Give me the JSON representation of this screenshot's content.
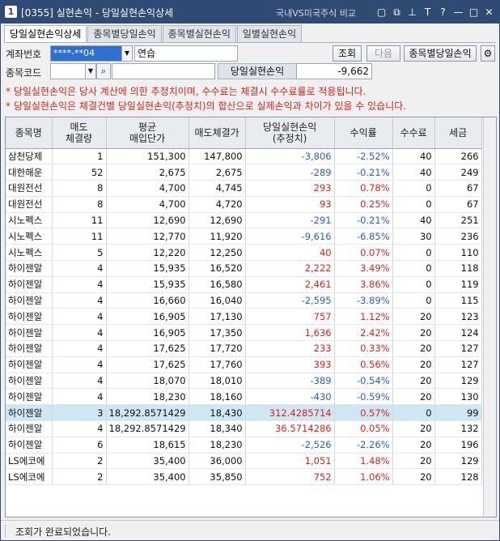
{
  "window": {
    "number": "1",
    "title": "[0355] 실현손익 - 당일실현손익상세",
    "compare_link": "국내VS미국주식 비교",
    "icons": [
      "window-icon",
      "copy-icon",
      "pin-icon",
      "font-size-icon",
      "help-icon",
      "minimize-icon",
      "maximize-icon",
      "close-icon"
    ],
    "icon_glyphs": [
      "▢",
      "⧉",
      "⊥",
      "T",
      "?",
      "—",
      "□",
      "✕"
    ]
  },
  "tabs": [
    {
      "label": "당일실현손익상세",
      "active": true
    },
    {
      "label": "종목별당일손익",
      "active": false
    },
    {
      "label": "종목별실현손익",
      "active": false
    },
    {
      "label": "일별실현손익",
      "active": false
    }
  ],
  "form": {
    "account_label": "계좌번호",
    "account_value": "****-**04",
    "account_name": "연습",
    "stock_code_label": "종목코드",
    "stock_code_value": "",
    "stock_name_value": "",
    "query_button": "조회",
    "next_button": "다음",
    "by_stock_button": "종목별당일손익",
    "pnl_label": "당일실현손익",
    "pnl_value": "-9,662"
  },
  "notices": [
    "* 당일실현손익은 당사 계산에 의한 추정치이며, 수수료는 체결시 수수료률로 적용됩니다.",
    "* 당일실현손익은 체결건별 당일실현손익(추정치)의 합산으로 실제손익과 차이가 있을 수 있습니다."
  ],
  "table": {
    "headers": [
      "종목명",
      "매도\n체결량",
      "평균\n매입단가",
      "매도체결가",
      "당일실현손익\n(추정치)",
      "수익률",
      "수수료",
      "세금"
    ],
    "rows": [
      {
        "name": "삼천당제",
        "qty": "1",
        "avg": "151,300",
        "sell": "147,800",
        "pnl": "-3,806",
        "rate": "-2.52%",
        "fee": "40",
        "tax": "266",
        "sign": "neg"
      },
      {
        "name": "대한해운",
        "qty": "52",
        "avg": "2,675",
        "sell": "2,675",
        "pnl": "-289",
        "rate": "-0.21%",
        "fee": "40",
        "tax": "249",
        "sign": "neg"
      },
      {
        "name": "대원전선",
        "qty": "8",
        "avg": "4,700",
        "sell": "4,745",
        "pnl": "293",
        "rate": "0.78%",
        "fee": "0",
        "tax": "67",
        "sign": "pos"
      },
      {
        "name": "대원전선",
        "qty": "8",
        "avg": "4,700",
        "sell": "4,720",
        "pnl": "93",
        "rate": "0.25%",
        "fee": "0",
        "tax": "67",
        "sign": "pos"
      },
      {
        "name": "시노펙스",
        "qty": "11",
        "avg": "12,690",
        "sell": "12,690",
        "pnl": "-291",
        "rate": "-0.21%",
        "fee": "40",
        "tax": "251",
        "sign": "neg"
      },
      {
        "name": "시노펙스",
        "qty": "11",
        "avg": "12,770",
        "sell": "11,920",
        "pnl": "-9,616",
        "rate": "-6.85%",
        "fee": "30",
        "tax": "236",
        "sign": "neg"
      },
      {
        "name": "시노펙스",
        "qty": "5",
        "avg": "12,220",
        "sell": "12,250",
        "pnl": "40",
        "rate": "0.07%",
        "fee": "0",
        "tax": "110",
        "sign": "pos"
      },
      {
        "name": "하이젠알",
        "qty": "4",
        "avg": "15,935",
        "sell": "16,520",
        "pnl": "2,222",
        "rate": "3.49%",
        "fee": "0",
        "tax": "118",
        "sign": "pos"
      },
      {
        "name": "하이젠알",
        "qty": "4",
        "avg": "15,935",
        "sell": "16,580",
        "pnl": "2,461",
        "rate": "3.86%",
        "fee": "0",
        "tax": "119",
        "sign": "pos"
      },
      {
        "name": "하이젠알",
        "qty": "4",
        "avg": "16,660",
        "sell": "16,040",
        "pnl": "-2,595",
        "rate": "-3.89%",
        "fee": "0",
        "tax": "115",
        "sign": "neg"
      },
      {
        "name": "하이젠알",
        "qty": "4",
        "avg": "16,905",
        "sell": "17,130",
        "pnl": "757",
        "rate": "1.12%",
        "fee": "20",
        "tax": "123",
        "sign": "pos"
      },
      {
        "name": "하이젠알",
        "qty": "4",
        "avg": "16,905",
        "sell": "17,350",
        "pnl": "1,636",
        "rate": "2.42%",
        "fee": "20",
        "tax": "124",
        "sign": "pos"
      },
      {
        "name": "하이젠알",
        "qty": "4",
        "avg": "17,625",
        "sell": "17,720",
        "pnl": "233",
        "rate": "0.33%",
        "fee": "20",
        "tax": "127",
        "sign": "pos"
      },
      {
        "name": "하이젠알",
        "qty": "4",
        "avg": "17,625",
        "sell": "17,760",
        "pnl": "393",
        "rate": "0.56%",
        "fee": "20",
        "tax": "127",
        "sign": "pos"
      },
      {
        "name": "하이젠알",
        "qty": "4",
        "avg": "18,070",
        "sell": "18,010",
        "pnl": "-389",
        "rate": "-0.54%",
        "fee": "20",
        "tax": "129",
        "sign": "neg"
      },
      {
        "name": "하이젠알",
        "qty": "4",
        "avg": "18,230",
        "sell": "18,160",
        "pnl": "-430",
        "rate": "-0.59%",
        "fee": "20",
        "tax": "130",
        "sign": "neg"
      },
      {
        "name": "하이젠알",
        "qty": "3",
        "avg": "18,292.8571429",
        "sell": "18,430",
        "pnl": "312.4285714",
        "rate": "0.57%",
        "fee": "0",
        "tax": "99",
        "sign": "pos",
        "selected": true
      },
      {
        "name": "하이젠알",
        "qty": "4",
        "avg": "18,292.8571429",
        "sell": "18,340",
        "pnl": "36.5714286",
        "rate": "0.05%",
        "fee": "20",
        "tax": "132",
        "sign": "pos"
      },
      {
        "name": "하이젠알",
        "qty": "6",
        "avg": "18,615",
        "sell": "18,230",
        "pnl": "-2,526",
        "rate": "-2.26%",
        "fee": "20",
        "tax": "196",
        "sign": "neg"
      },
      {
        "name": "LS에코에",
        "qty": "2",
        "avg": "35,400",
        "sell": "36,000",
        "pnl": "1,051",
        "rate": "1.48%",
        "fee": "20",
        "tax": "129",
        "sign": "pos"
      },
      {
        "name": "LS에코에",
        "qty": "2",
        "avg": "35,400",
        "sell": "35,850",
        "pnl": "752",
        "rate": "1.06%",
        "fee": "20",
        "tax": "128",
        "sign": "pos"
      }
    ]
  },
  "status": "조회가 완료되었습니다."
}
